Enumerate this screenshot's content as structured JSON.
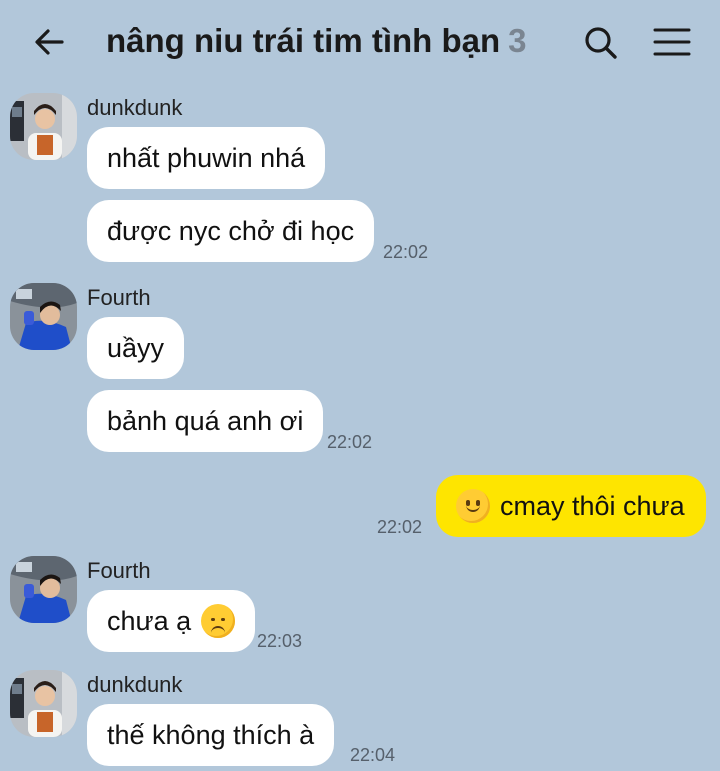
{
  "header": {
    "title": "nâng niu trái tim tình bạn",
    "member_count": "3"
  },
  "messages": [
    {
      "sender": "dunkdunk",
      "lines": [
        "nhất phuwin nhá",
        "được nyc chở đi học"
      ],
      "time": "22:02"
    },
    {
      "sender": "Fourth",
      "lines": [
        "uầyy",
        "bảnh quá anh ơi"
      ],
      "time": "22:02"
    },
    {
      "outgoing": true,
      "emoji": "slightly-smiling-face",
      "text": "cmay thôi chưa",
      "time": "22:02"
    },
    {
      "sender": "Fourth",
      "text": "chưa ạ",
      "emoji": "disappointed-face",
      "time": "22:03"
    },
    {
      "sender": "dunkdunk",
      "text": "thế không thích à",
      "time": "22:04"
    }
  ],
  "colors": {
    "background": "#b2c7da",
    "incoming_bubble": "#ffffff",
    "outgoing_bubble": "#fee500"
  },
  "icons": [
    "back-arrow-icon",
    "search-icon",
    "menu-icon"
  ]
}
